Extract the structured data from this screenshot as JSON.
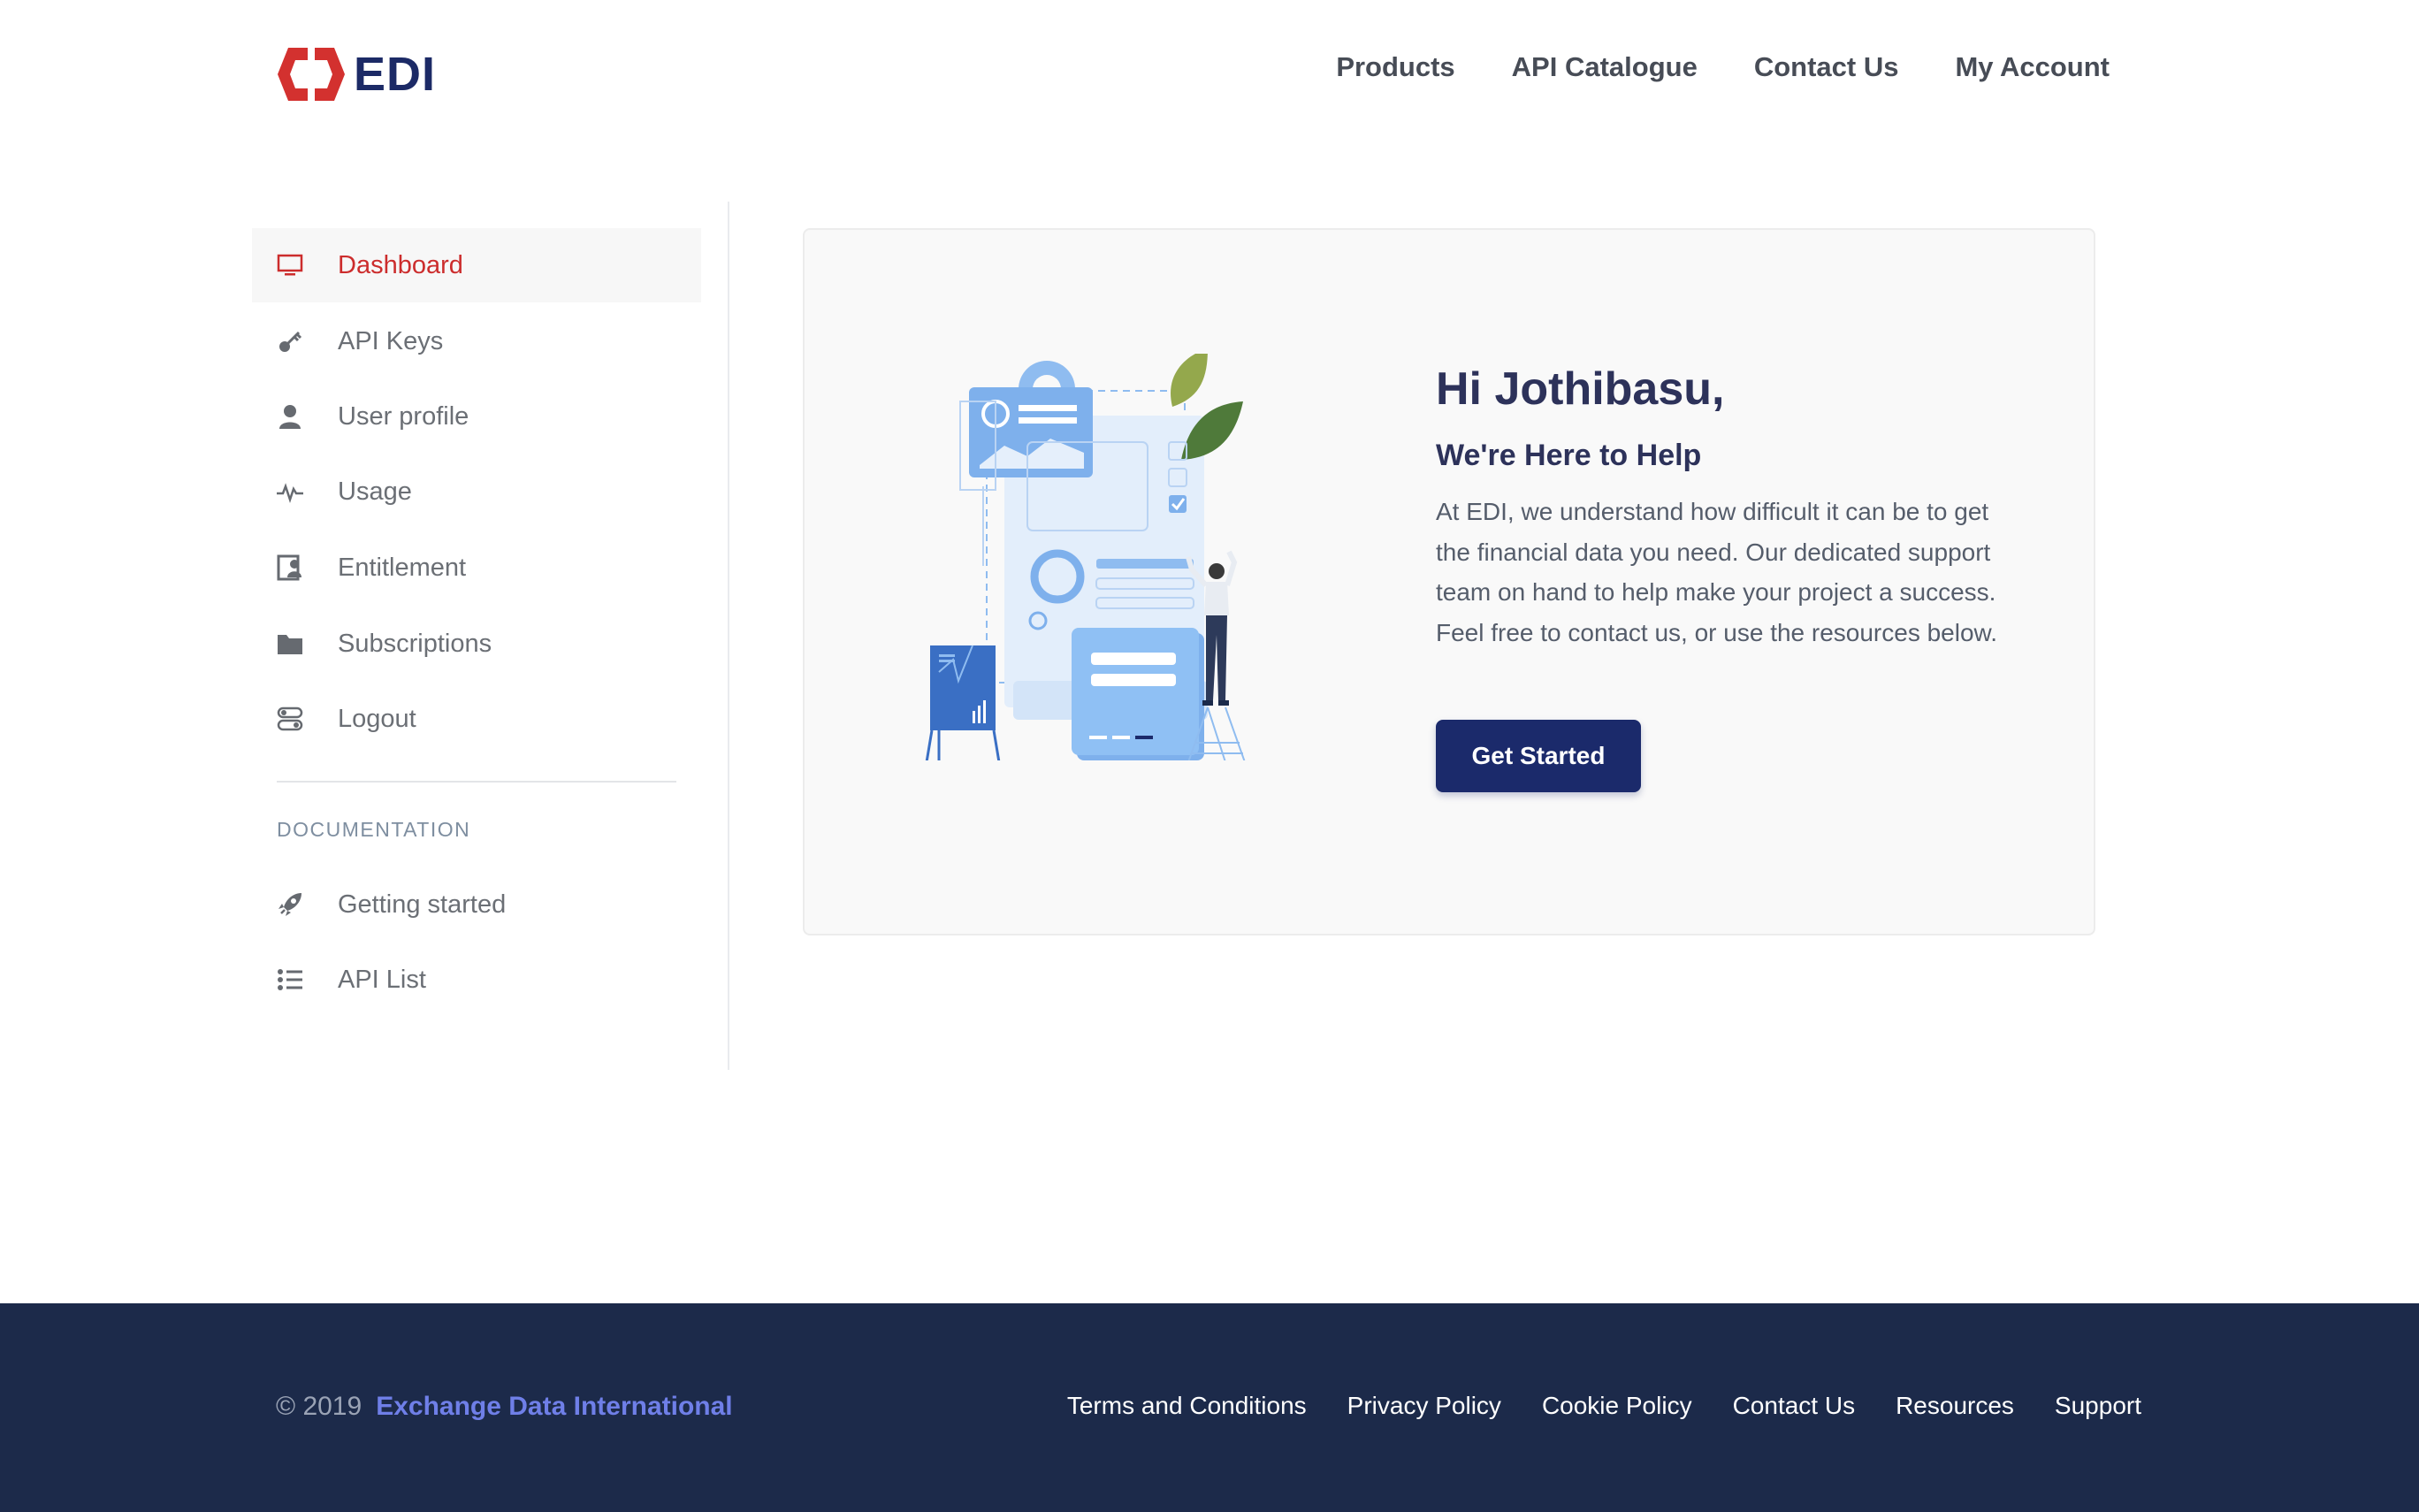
{
  "brand": {
    "name": "EDI",
    "accent": "#d3312f",
    "primary": "#1b2a6b"
  },
  "topnav": {
    "items": [
      {
        "label": "Products"
      },
      {
        "label": "API Catalogue"
      },
      {
        "label": "Contact Us"
      },
      {
        "label": "My Account"
      }
    ]
  },
  "sidebar": {
    "items": [
      {
        "label": "Dashboard",
        "icon": "monitor-icon",
        "active": true
      },
      {
        "label": "API Keys",
        "icon": "key-icon"
      },
      {
        "label": "User profile",
        "icon": "user-icon"
      },
      {
        "label": "Usage",
        "icon": "activity-icon"
      },
      {
        "label": "Entitlement",
        "icon": "contact-card-icon"
      },
      {
        "label": "Subscriptions",
        "icon": "folder-icon"
      },
      {
        "label": "Logout",
        "icon": "logout-icon"
      }
    ],
    "docs_heading": "DOCUMENTATION",
    "docs_items": [
      {
        "label": "Getting started",
        "icon": "rocket-icon"
      },
      {
        "label": "API List",
        "icon": "list-icon"
      }
    ]
  },
  "welcome": {
    "greeting": "Hi Jothibasu,",
    "subheading": "We're Here to Help",
    "body": "At EDI, we understand how difficult it can be to get the financial data you need. Our dedicated support team on hand to help make your project a success. Feel free to contact us, or use the resources below.",
    "cta_label": "Get Started"
  },
  "footer": {
    "copyright": "© 2019",
    "company": "Exchange Data International",
    "links": [
      {
        "label": "Terms and Conditions"
      },
      {
        "label": "Privacy Policy"
      },
      {
        "label": "Cookie Policy"
      },
      {
        "label": "Contact Us"
      },
      {
        "label": "Resources"
      },
      {
        "label": "Support"
      }
    ]
  }
}
